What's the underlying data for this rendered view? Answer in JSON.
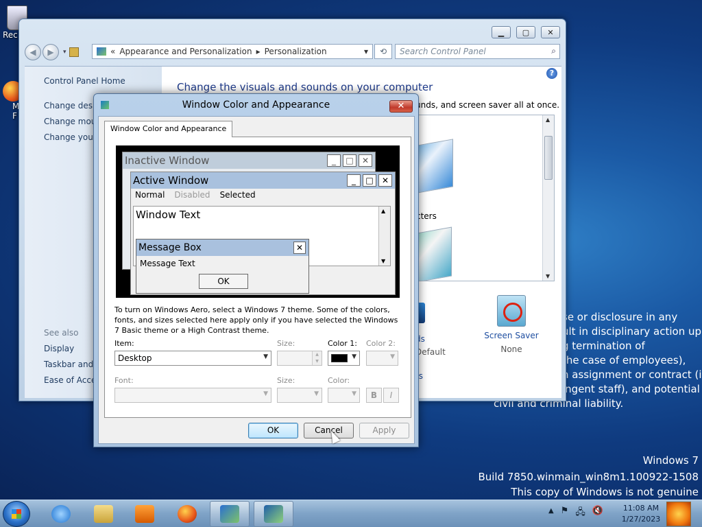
{
  "desktop": {
    "icons": [
      {
        "label": "Rec",
        "icon": "recycle-bin-icon"
      },
      {
        "label": "M\nF",
        "icon": "firefox-icon"
      }
    ],
    "legal_lines": [
      "se or disclosure in any",
      "ult in disciplinary action up",
      "g termination of",
      " the case of employees),",
      "n assignment or contract (in",
      "ingent staff), and potential",
      "civil and criminal liability."
    ],
    "watermark": {
      "os": "Windows 7",
      "build": "Build 7850.winmain_win8m1.100922-1508",
      "genuine": "This copy of Windows is not genuine"
    }
  },
  "control_panel": {
    "caption_buttons": {
      "minimize": "▁",
      "maximize": "▢",
      "close": "✕"
    },
    "breadcrumb": {
      "prefix": "«",
      "part1": "Appearance and Personalization",
      "sep": "▸",
      "part2": "Personalization",
      "dropdown": "▾"
    },
    "refresh_icon": "⟲",
    "search_placeholder": "Search Control Panel",
    "search_icon": "⌕",
    "sidebar": {
      "home": "Control Panel Home",
      "links": [
        "Change deskt",
        "Change mous",
        "Change your"
      ],
      "see_also": "See also",
      "see_also_links": [
        "Display",
        "Taskbar and S",
        "Ease of Acces"
      ]
    },
    "help": "?",
    "title": "Change the visuals and sounds on your computer",
    "desc": "unds, and screen saver all at once.",
    "theme_label": "cters",
    "bottom_fragments": {
      "ds": "ds",
      "default": "Default",
      "ts": "ts"
    },
    "screen_saver": {
      "label": "Screen Saver",
      "value": "None"
    }
  },
  "dialog": {
    "title": "Window Color and Appearance",
    "close": "✕",
    "tab": "Window Color and Appearance",
    "preview": {
      "inactive_title": "Inactive Window",
      "active_title": "Active Window",
      "menu": {
        "normal": "Normal",
        "disabled": "Disabled",
        "selected": "Selected"
      },
      "window_text": "Window Text",
      "msgbox_title": "Message Box",
      "msgbox_text": "Message Text",
      "ok": "OK",
      "min": "_",
      "max": "□",
      "close": "✕"
    },
    "note": "To turn on Windows Aero, select a Windows 7 theme.  Some of the colors, fonts, and sizes selected here apply only if you have selected the Windows 7 Basic theme or a High Contrast theme.",
    "item_label": "Item:",
    "item_value": "Desktop",
    "size_label": "Size:",
    "color1_label": "Color 1:",
    "color1_value": "#000000",
    "color2_label": "Color 2:",
    "font_label": "Font:",
    "font_size_label": "Size:",
    "font_color_label": "Color:",
    "bold": "B",
    "italic": "I",
    "buttons": {
      "ok": "OK",
      "cancel": "Cancel",
      "apply": "Apply"
    }
  },
  "taskbar": {
    "pinned": [
      "internet-explorer-icon",
      "windows-explorer-icon",
      "media-player-icon",
      "firefox-icon",
      "control-panel-icon",
      "window-color-icon"
    ],
    "tray_icons": [
      "▲",
      "⚑",
      "🖧",
      "🔇"
    ],
    "time": "11:08 AM",
    "date": "1/27/2023"
  }
}
